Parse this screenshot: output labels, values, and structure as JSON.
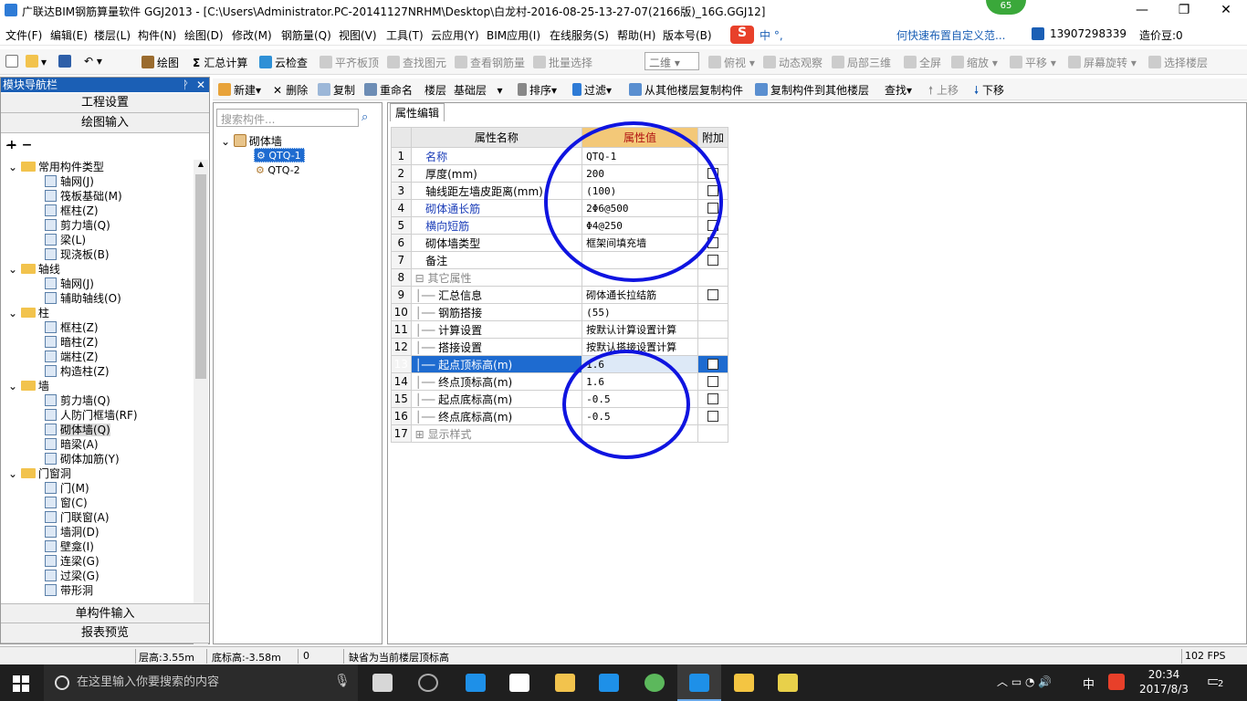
{
  "window": {
    "title": "广联达BIM钢筋算量软件 GGJ2013 - [C:\\Users\\Administrator.PC-20141127NRHM\\Desktop\\白龙村-2016-08-25-13-27-07(2166版)_16G.GGJ12]",
    "badge": "65"
  },
  "menu": {
    "items": [
      "文件(F)",
      "编辑(E)",
      "楼层(L)",
      "构件(N)",
      "绘图(D)",
      "修改(M)",
      "钢筋量(Q)",
      "视图(V)",
      "工具(T)",
      "云应用(Y)",
      "BIM应用(I)",
      "在线服务(S)",
      "帮助(H)",
      "版本号(B)"
    ],
    "ime": "中 °,",
    "tip": "何快速布置自定义范...",
    "phone": "13907298339",
    "bean": "造价豆:0"
  },
  "toolbar1": {
    "draw": "绘图",
    "sum": "汇总计算",
    "cloud_check": "云检查",
    "flat": "平齐板顶",
    "find_elem": "查找图元",
    "view_rebar": "查看钢筋量",
    "batch": "批量选择",
    "view_mode": "二维",
    "top_view": "俯视",
    "dynamic": "动态观察",
    "local3d": "局部三维",
    "full": "全屏",
    "zoom": "缩放",
    "pan": "平移",
    "rotate": "屏幕旋转",
    "select_floor": "选择楼层"
  },
  "toolbar2": {
    "new": "新建",
    "delete": "删除",
    "copy": "复制",
    "rename": "重命名",
    "floor_label": "楼层",
    "floor_value": "基础层",
    "sort": "排序",
    "filter": "过滤",
    "copy_from": "从其他楼层复制构件",
    "copy_to": "复制构件到其他楼层",
    "find": "查找",
    "up": "上移",
    "down": "下移"
  },
  "nav": {
    "title": "模块导航栏",
    "project": "工程设置",
    "draw_input": "绘图输入",
    "single_input": "单构件输入",
    "report": "报表预览",
    "tree": [
      {
        "label": "常用构件类型",
        "level": 0,
        "folder": true
      },
      {
        "label": "轴网(J)",
        "level": 1
      },
      {
        "label": "筏板基础(M)",
        "level": 1
      },
      {
        "label": "框柱(Z)",
        "level": 1
      },
      {
        "label": "剪力墙(Q)",
        "level": 1
      },
      {
        "label": "梁(L)",
        "level": 1
      },
      {
        "label": "现浇板(B)",
        "level": 1
      },
      {
        "label": "轴线",
        "level": 0,
        "folder": true
      },
      {
        "label": "轴网(J)",
        "level": 1
      },
      {
        "label": "辅助轴线(O)",
        "level": 1
      },
      {
        "label": "柱",
        "level": 0,
        "folder": true
      },
      {
        "label": "框柱(Z)",
        "level": 1
      },
      {
        "label": "暗柱(Z)",
        "level": 1
      },
      {
        "label": "端柱(Z)",
        "level": 1
      },
      {
        "label": "构造柱(Z)",
        "level": 1
      },
      {
        "label": "墙",
        "level": 0,
        "folder": true
      },
      {
        "label": "剪力墙(Q)",
        "level": 1
      },
      {
        "label": "人防门框墙(RF)",
        "level": 1
      },
      {
        "label": "砌体墙(Q)",
        "level": 1,
        "selected": true
      },
      {
        "label": "暗梁(A)",
        "level": 1
      },
      {
        "label": "砌体加筋(Y)",
        "level": 1
      },
      {
        "label": "门窗洞",
        "level": 0,
        "folder": true
      },
      {
        "label": "门(M)",
        "level": 1
      },
      {
        "label": "窗(C)",
        "level": 1
      },
      {
        "label": "门联窗(A)",
        "level": 1
      },
      {
        "label": "墙洞(D)",
        "level": 1
      },
      {
        "label": "壁龛(I)",
        "level": 1
      },
      {
        "label": "连梁(G)",
        "level": 1
      },
      {
        "label": "过梁(G)",
        "level": 1
      },
      {
        "label": "带形洞",
        "level": 1
      }
    ]
  },
  "components": {
    "search_placeholder": "搜索构件...",
    "root": "砌体墙",
    "items": [
      "QTQ-1",
      "QTQ-2"
    ]
  },
  "props": {
    "tab": "属性编辑",
    "headers": [
      "属性名称",
      "属性值",
      "附加"
    ],
    "rows": [
      {
        "n": "1",
        "name": "名称",
        "value": "QTQ-1",
        "blue": true,
        "cb": false
      },
      {
        "n": "2",
        "name": "厚度(mm)",
        "value": "200",
        "cb": true
      },
      {
        "n": "3",
        "name": "轴线距左墙皮距离(mm)",
        "value": "(100)",
        "cb": true
      },
      {
        "n": "4",
        "name": "砌体通长筋",
        "value": "2Φ6@500",
        "blue": true,
        "cb": true
      },
      {
        "n": "5",
        "name": "横向短筋",
        "value": "Φ4@250",
        "blue": true,
        "cb": true
      },
      {
        "n": "6",
        "name": "砌体墙类型",
        "value": "框架间填充墙",
        "cb": true
      },
      {
        "n": "7",
        "name": "备注",
        "value": "",
        "cb": true
      },
      {
        "n": "8",
        "name": "其它属性",
        "value": "",
        "group": true
      },
      {
        "n": "9",
        "name": "汇总信息",
        "value": "砌体通长拉结筋",
        "sub": true,
        "cb": true
      },
      {
        "n": "10",
        "name": "钢筋搭接",
        "value": "(55)",
        "sub": true
      },
      {
        "n": "11",
        "name": "计算设置",
        "value": "按默认计算设置计算",
        "sub": true
      },
      {
        "n": "12",
        "name": "搭接设置",
        "value": "按默认搭接设置计算",
        "sub": true
      },
      {
        "n": "13",
        "name": "起点顶标高(m)",
        "value": "1.6",
        "sub": true,
        "selected": true,
        "cb": true
      },
      {
        "n": "14",
        "name": "终点顶标高(m)",
        "value": "1.6",
        "sub": true,
        "cb": true
      },
      {
        "n": "15",
        "name": "起点底标高(m)",
        "value": "-0.5",
        "sub": true,
        "cb": true
      },
      {
        "n": "16",
        "name": "终点底标高(m)",
        "value": "-0.5",
        "sub": true,
        "cb": true
      },
      {
        "n": "17",
        "name": "显示样式",
        "value": "",
        "group": true,
        "collapsed": true
      }
    ]
  },
  "status": {
    "floor_h": "层高:3.55m",
    "base_h": "底标高:-3.58m",
    "zero": "0",
    "msg": "缺省为当前楼层顶标高",
    "fps": "102 FPS"
  },
  "taskbar": {
    "search": "在这里输入你要搜索的内容",
    "ime": "中",
    "time": "20:34",
    "date": "2017/8/3",
    "notify": "2"
  },
  "colors": {
    "accent": "#1b5fb5",
    "circle": "#0f14e0",
    "header_value": "#f3c878"
  }
}
